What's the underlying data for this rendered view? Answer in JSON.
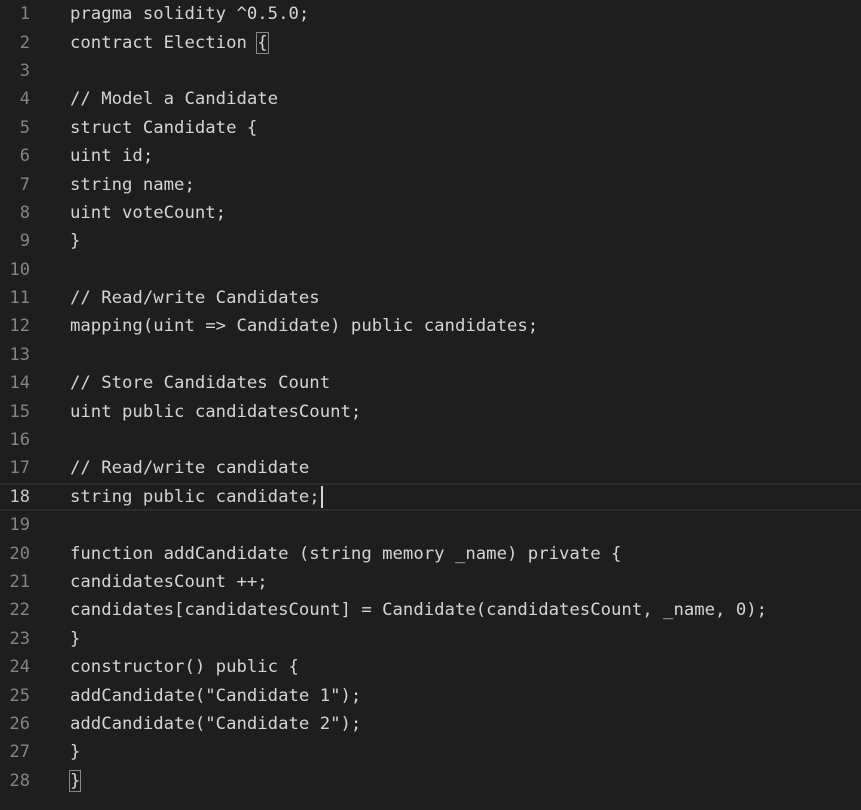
{
  "editor": {
    "current_line": 18,
    "lines": [
      {
        "number": "1",
        "text": "pragma solidity ^0.5.0;"
      },
      {
        "number": "2",
        "text": "contract Election {"
      },
      {
        "number": "3",
        "text": ""
      },
      {
        "number": "4",
        "text": "// Model a Candidate"
      },
      {
        "number": "5",
        "text": "struct Candidate {"
      },
      {
        "number": "6",
        "text": "uint id;"
      },
      {
        "number": "7",
        "text": "string name;"
      },
      {
        "number": "8",
        "text": "uint voteCount;"
      },
      {
        "number": "9",
        "text": "}"
      },
      {
        "number": "10",
        "text": ""
      },
      {
        "number": "11",
        "text": "// Read/write Candidates"
      },
      {
        "number": "12",
        "text": "mapping(uint => Candidate) public candidates;"
      },
      {
        "number": "13",
        "text": ""
      },
      {
        "number": "14",
        "text": "// Store Candidates Count"
      },
      {
        "number": "15",
        "text": "uint public candidatesCount;"
      },
      {
        "number": "16",
        "text": ""
      },
      {
        "number": "17",
        "text": "// Read/write candidate"
      },
      {
        "number": "18",
        "text": "string public candidate;"
      },
      {
        "number": "19",
        "text": ""
      },
      {
        "number": "20",
        "text": "function addCandidate (string memory _name) private {"
      },
      {
        "number": "21",
        "text": "candidatesCount ++;"
      },
      {
        "number": "22",
        "text": "candidates[candidatesCount] = Candidate(candidatesCount, _name, 0);"
      },
      {
        "number": "23",
        "text": "}"
      },
      {
        "number": "24",
        "text": "constructor() public {"
      },
      {
        "number": "25",
        "text": "addCandidate(\"Candidate 1\");"
      },
      {
        "number": "26",
        "text": "addCandidate(\"Candidate 2\");"
      },
      {
        "number": "27",
        "text": "}"
      },
      {
        "number": "28",
        "text": "}"
      }
    ]
  },
  "colors": {
    "background": "#1e1e1e",
    "text": "#d4d4d4",
    "line_number": "#858585",
    "current_line_number": "#c6c6c6"
  }
}
